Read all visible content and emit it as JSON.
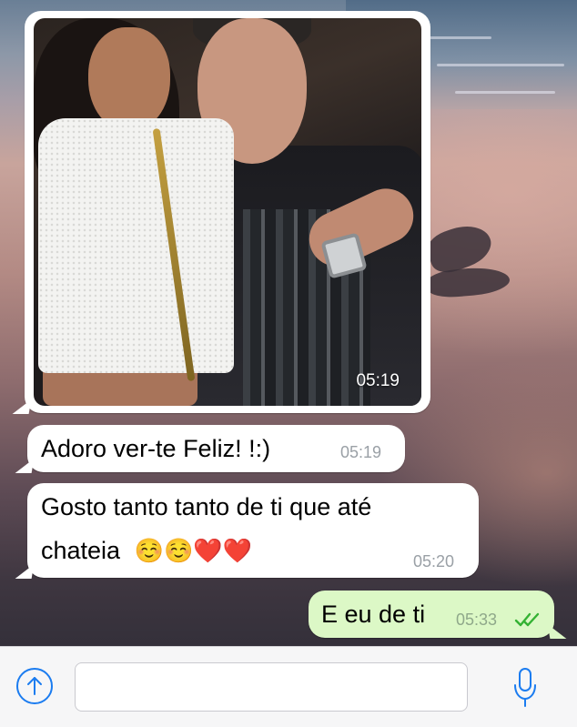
{
  "chat": {
    "messages": [
      {
        "direction": "incoming",
        "type": "photo",
        "time": "05:19"
      },
      {
        "direction": "incoming",
        "type": "text",
        "text": "Adoro ver-te Feliz! !:)",
        "time": "05:19"
      },
      {
        "direction": "incoming",
        "type": "text",
        "line1": "Gosto tanto tanto de ti que até",
        "line2": "chateia",
        "emoji": "☺️☺️❤️❤️",
        "time": "05:20"
      },
      {
        "direction": "outgoing",
        "type": "text",
        "text": "E eu de ti",
        "time": "05:33",
        "status": "read"
      }
    ]
  },
  "input_bar": {
    "upload_icon": "upload-arrow-icon",
    "message_placeholder": "",
    "mic_icon": "microphone-icon"
  },
  "colors": {
    "accent": "#1b7cf0",
    "outgoing_bubble": "#dcf8c6",
    "incoming_bubble": "#ffffff",
    "read_ticks": "#34b233"
  }
}
